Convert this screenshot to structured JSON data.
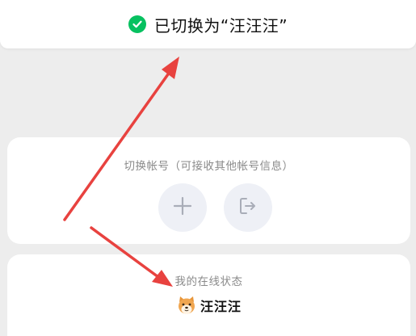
{
  "toast": {
    "message": "已切换为“汪汪汪”",
    "icon": "check-circle-icon",
    "icon_color": "#07c160"
  },
  "switch_account": {
    "title": "切换帐号（可接收其他帐号信息）",
    "add_button_icon": "plus-icon",
    "logout_button_icon": "logout-icon"
  },
  "online_status": {
    "title": "我的在线状态",
    "status_icon": "dog-face-icon",
    "status_name": "汪汪汪"
  },
  "annotation": {
    "arrow_color": "#e8423f"
  }
}
